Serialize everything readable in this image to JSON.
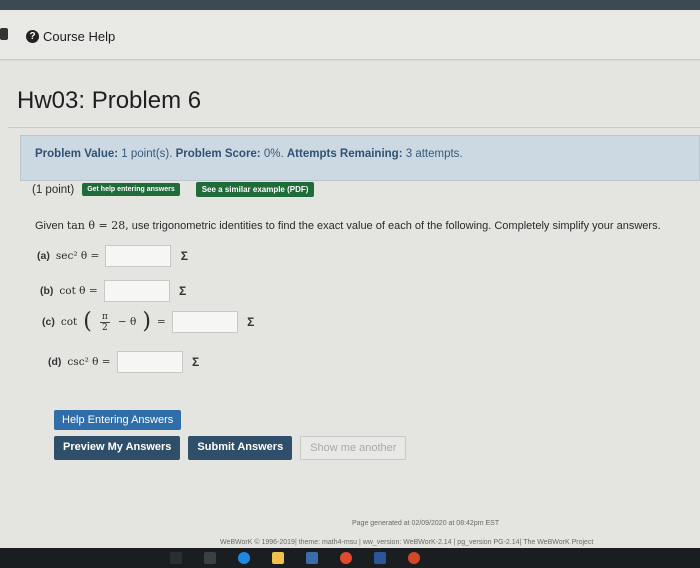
{
  "nav": {
    "course_help": "Course Help"
  },
  "title": "Hw03: Problem 6",
  "problem_info": {
    "value_label": "Problem Value:",
    "value": "1 point(s).",
    "score_label": "Problem Score:",
    "score": "0%.",
    "attempts_label": "Attempts Remaining:",
    "attempts": "3 attempts."
  },
  "problem": {
    "points": "(1 point)",
    "help_btn": "Get help entering answers",
    "similar_btn": "See a similar example (PDF)",
    "given_prefix": "Given",
    "given_math": "tan θ = 28,",
    "given_text": "use trigonometric identities to find the exact value of each of the following. Completely simplify your answers.",
    "parts": [
      {
        "label": "(a)",
        "expr": "sec² θ ="
      },
      {
        "label": "(b)",
        "expr": "cot θ ="
      },
      {
        "label": "(c)",
        "expr_pre": "cot",
        "pi": "π",
        "two": "2",
        "expr_post": "− θ",
        "eq": "="
      },
      {
        "label": "(d)",
        "expr": "csc² θ ="
      }
    ],
    "sigma": "Σ"
  },
  "buttons": {
    "help_entering": "Help Entering Answers",
    "preview": "Preview My Answers",
    "submit": "Submit Answers",
    "show_another": "Show me another"
  },
  "footer": {
    "generated": "Page generated at 02/09/2020 at 08:42pm EST",
    "credits": "WeBWorK © 1996-2019| theme: math4-msu | ww_version: WeBWorK-2.14 | pg_version PG-2.14| The WeBWorK Project"
  }
}
